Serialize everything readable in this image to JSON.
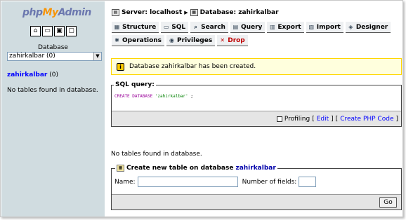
{
  "nav": {
    "logo": {
      "php": "php",
      "my": "My",
      "admin": "Admin"
    },
    "icons": [
      "home-icon",
      "sql-query-icon",
      "documentation-icon",
      "sql-docs-icon"
    ],
    "database_label": "Database",
    "database_selected": "zahirkalbar (0)",
    "db_name": "zahirkalbar",
    "db_count": "(0)",
    "no_tables": "No tables found in database."
  },
  "breadcrumb": {
    "server": "Server: localhost",
    "database": "Database: zahirkalbar"
  },
  "tabs_row1": [
    {
      "label": "Structure",
      "icon": "structure-icon"
    },
    {
      "label": "SQL",
      "icon": "sql-icon"
    },
    {
      "label": "Search",
      "icon": "search-icon"
    },
    {
      "label": "Query",
      "icon": "query-icon"
    },
    {
      "label": "Export",
      "icon": "export-icon"
    },
    {
      "label": "Import",
      "icon": "import-icon"
    },
    {
      "label": "Designer",
      "icon": "designer-icon"
    }
  ],
  "tabs_row2": [
    {
      "label": "Operations",
      "icon": "operations-icon"
    },
    {
      "label": "Privileges",
      "icon": "privileges-icon"
    },
    {
      "label": "Drop",
      "icon": "drop-icon"
    }
  ],
  "notice": {
    "text": "Database zahirkalbar has been created."
  },
  "sql_query": {
    "legend": "SQL query:",
    "keyword": "CREATE DATABASE",
    "value": "'zahirkalbar'",
    "suffix": " ;",
    "profiling_label": "Profiling",
    "edit_label": "Edit",
    "create_php_label": "Create PHP Code"
  },
  "main_no_tables": "No tables found in database.",
  "create_table": {
    "legend_prefix": "Create new table on database",
    "db_name": "zahirkalbar",
    "name_label": "Name:",
    "fields_label": "Number of fields:",
    "name_value": "",
    "fields_value": "",
    "go_label": "Go"
  },
  "colors": {
    "nav_bg": "#d0dce0",
    "notice_bg": "#ffffdd",
    "link": "#0000ff",
    "drop": "#c00000"
  }
}
